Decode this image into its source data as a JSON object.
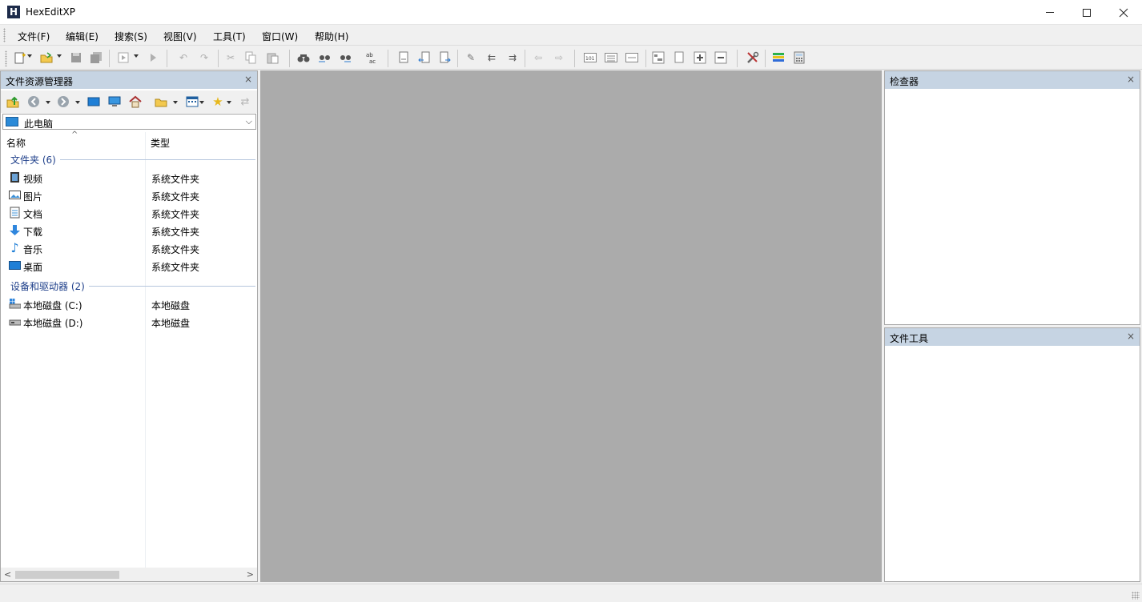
{
  "window": {
    "title": "HexEditXP",
    "icon_letter": "H"
  },
  "menu": [
    "文件(F)",
    "编辑(E)",
    "搜索(S)",
    "视图(V)",
    "工具(T)",
    "窗口(W)",
    "帮助(H)"
  ],
  "toolbar_icons": [
    "new-file-icon",
    "open-file-icon",
    "save-icon",
    "save-all-icon",
    "run-macro-icon",
    "play-icon",
    "undo-icon",
    "redo-icon",
    "cut-icon",
    "copy-icon",
    "paste-icon",
    "find-icon",
    "find-prev-icon",
    "find-next-icon",
    "replace-icon",
    "insert-block-icon",
    "insert-before-icon",
    "insert-after-icon",
    "edit-icon",
    "shift-left-icon",
    "shift-right-icon",
    "back-icon",
    "forward-icon",
    "binary-view-icon",
    "list-view-icon",
    "strip-view-icon",
    "structure-icon",
    "page-icon",
    "zoom-in-icon",
    "zoom-out-icon",
    "tools-icon",
    "color-bars-icon",
    "calculator-icon"
  ],
  "explorer": {
    "title": "文件资源管理器",
    "close": "×",
    "location": "此电脑",
    "columns": {
      "name": "名称",
      "type": "类型"
    },
    "groups": [
      {
        "label": "文件夹 (6)",
        "items": [
          {
            "name": "视频",
            "type": "系统文件夹",
            "icon": "video-folder-icon"
          },
          {
            "name": "图片",
            "type": "系统文件夹",
            "icon": "pictures-folder-icon"
          },
          {
            "name": "文档",
            "type": "系统文件夹",
            "icon": "documents-folder-icon"
          },
          {
            "name": "下载",
            "type": "系统文件夹",
            "icon": "downloads-folder-icon"
          },
          {
            "name": "音乐",
            "type": "系统文件夹",
            "icon": "music-folder-icon"
          },
          {
            "name": "桌面",
            "type": "系统文件夹",
            "icon": "desktop-folder-icon"
          }
        ]
      },
      {
        "label": "设备和驱动器 (2)",
        "items": [
          {
            "name": "本地磁盘 (C:)",
            "type": "本地磁盘",
            "icon": "system-drive-icon"
          },
          {
            "name": "本地磁盘 (D:)",
            "type": "本地磁盘",
            "icon": "drive-icon"
          }
        ]
      }
    ]
  },
  "inspector": {
    "title": "检查器",
    "close": "×"
  },
  "file_tools": {
    "title": "文件工具",
    "close": "×"
  },
  "colors": {
    "panel_header": "#c6d4e3",
    "workspace": "#ababab",
    "group_header": "#1e3f8a"
  }
}
